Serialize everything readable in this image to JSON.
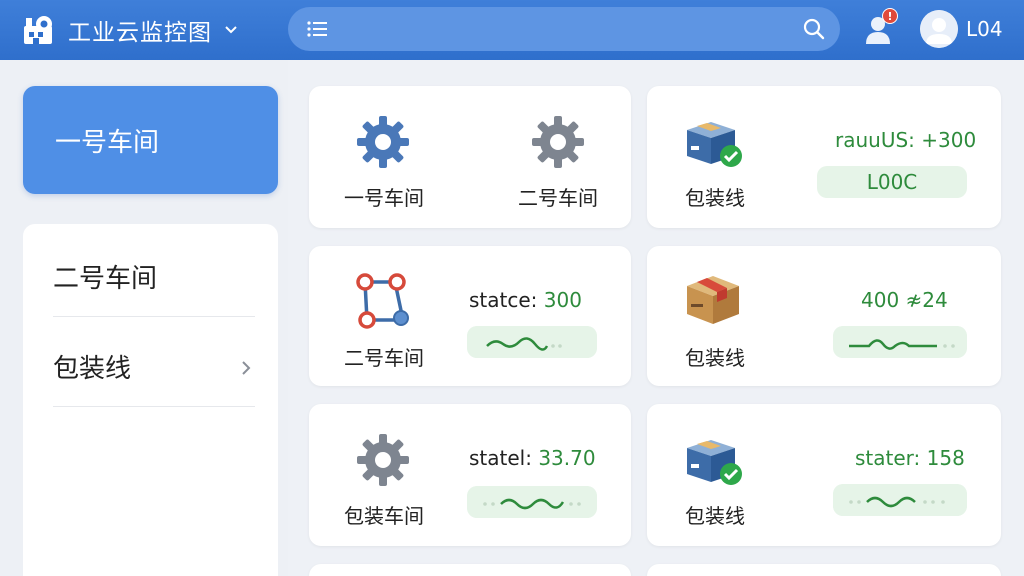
{
  "header": {
    "app_title": "工业云监控图",
    "search_placeholder": "",
    "notification_badge": "!",
    "user_name": "L04",
    "accent": "#2f6fcc"
  },
  "sidebar": {
    "items": [
      {
        "label": "一号车间",
        "active": true
      },
      {
        "label": "二号车间",
        "active": false
      },
      {
        "label": "包装线",
        "active": false
      }
    ]
  },
  "cards": [
    {
      "type": "dual-gear",
      "labels": [
        "一号车间",
        "二号车间"
      ]
    },
    {
      "type": "status-pill",
      "icon": "box-check-icon",
      "label": "包装线",
      "stat_key": "rauuUS:",
      "stat_value": "+300",
      "pill_text": "L00C"
    },
    {
      "type": "sparkline",
      "icon": "node-graph-icon",
      "label": "二号车间",
      "stat_key": "statce:",
      "stat_value": "300"
    },
    {
      "type": "sparkline",
      "icon": "box-icon",
      "label": "包装线",
      "stat_key": "",
      "stat_value": "400 ≉24"
    },
    {
      "type": "sparkline",
      "icon": "gear-icon",
      "label": "包装车间",
      "stat_key": "statel:",
      "stat_value": "33.70"
    },
    {
      "type": "sparkline",
      "icon": "box-check-icon",
      "label": "包装线",
      "stat_key": "stater:",
      "stat_value": "158"
    }
  ],
  "colors": {
    "status_green": "#2e8b3c",
    "pill_bg": "#e6f4e8",
    "sidebar_active": "#4f8fe6"
  }
}
